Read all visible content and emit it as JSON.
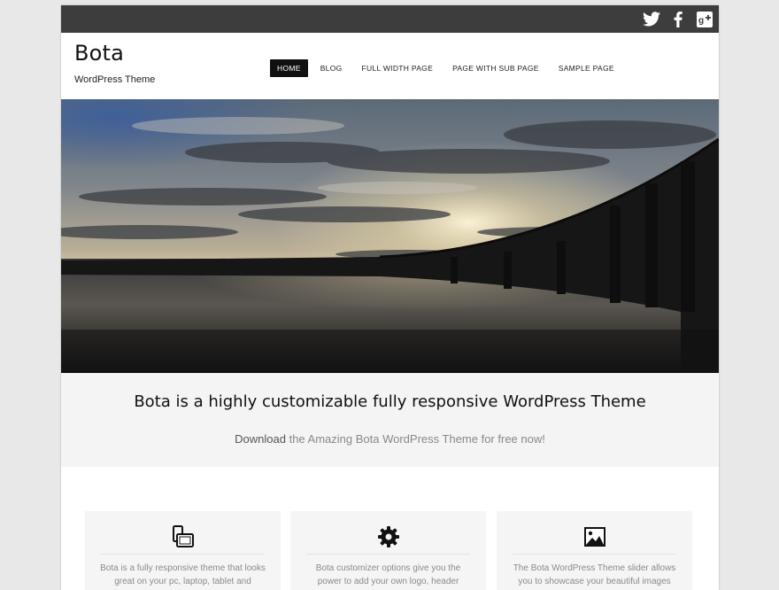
{
  "social": {
    "twitter": "twitter-icon",
    "facebook": "facebook-icon",
    "googleplus": "google-plus-icon"
  },
  "site": {
    "title": "Bota",
    "tagline": "WordPress Theme"
  },
  "nav": {
    "items": [
      "HOME",
      "BLOG",
      "FULL WIDTH PAGE",
      "PAGE WITH SUB PAGE",
      "SAMPLE PAGE"
    ],
    "active": "HOME"
  },
  "hero": {
    "image": "sunset-pier-photo"
  },
  "cta": {
    "title": "Bota is a highly customizable fully responsive WordPress Theme",
    "download": "Download",
    "rest": " the Amazing Bota WordPress Theme for free now!"
  },
  "features": [
    {
      "icon": "devices-icon",
      "text": "Bota is a fully responsive theme that looks great on your pc, laptop, tablet and"
    },
    {
      "icon": "gear-icon",
      "text": "Bota customizer options give you the power to add your own logo, header"
    },
    {
      "icon": "image-icon",
      "text": "The Bota WordPress Theme slider allows you to showcase your beautiful images"
    }
  ],
  "colors": {
    "topbar": "#3d3d3d",
    "nav_active": "#111111",
    "cta_bg": "#f4f4f4",
    "feature_bg": "#f5f5f5"
  }
}
